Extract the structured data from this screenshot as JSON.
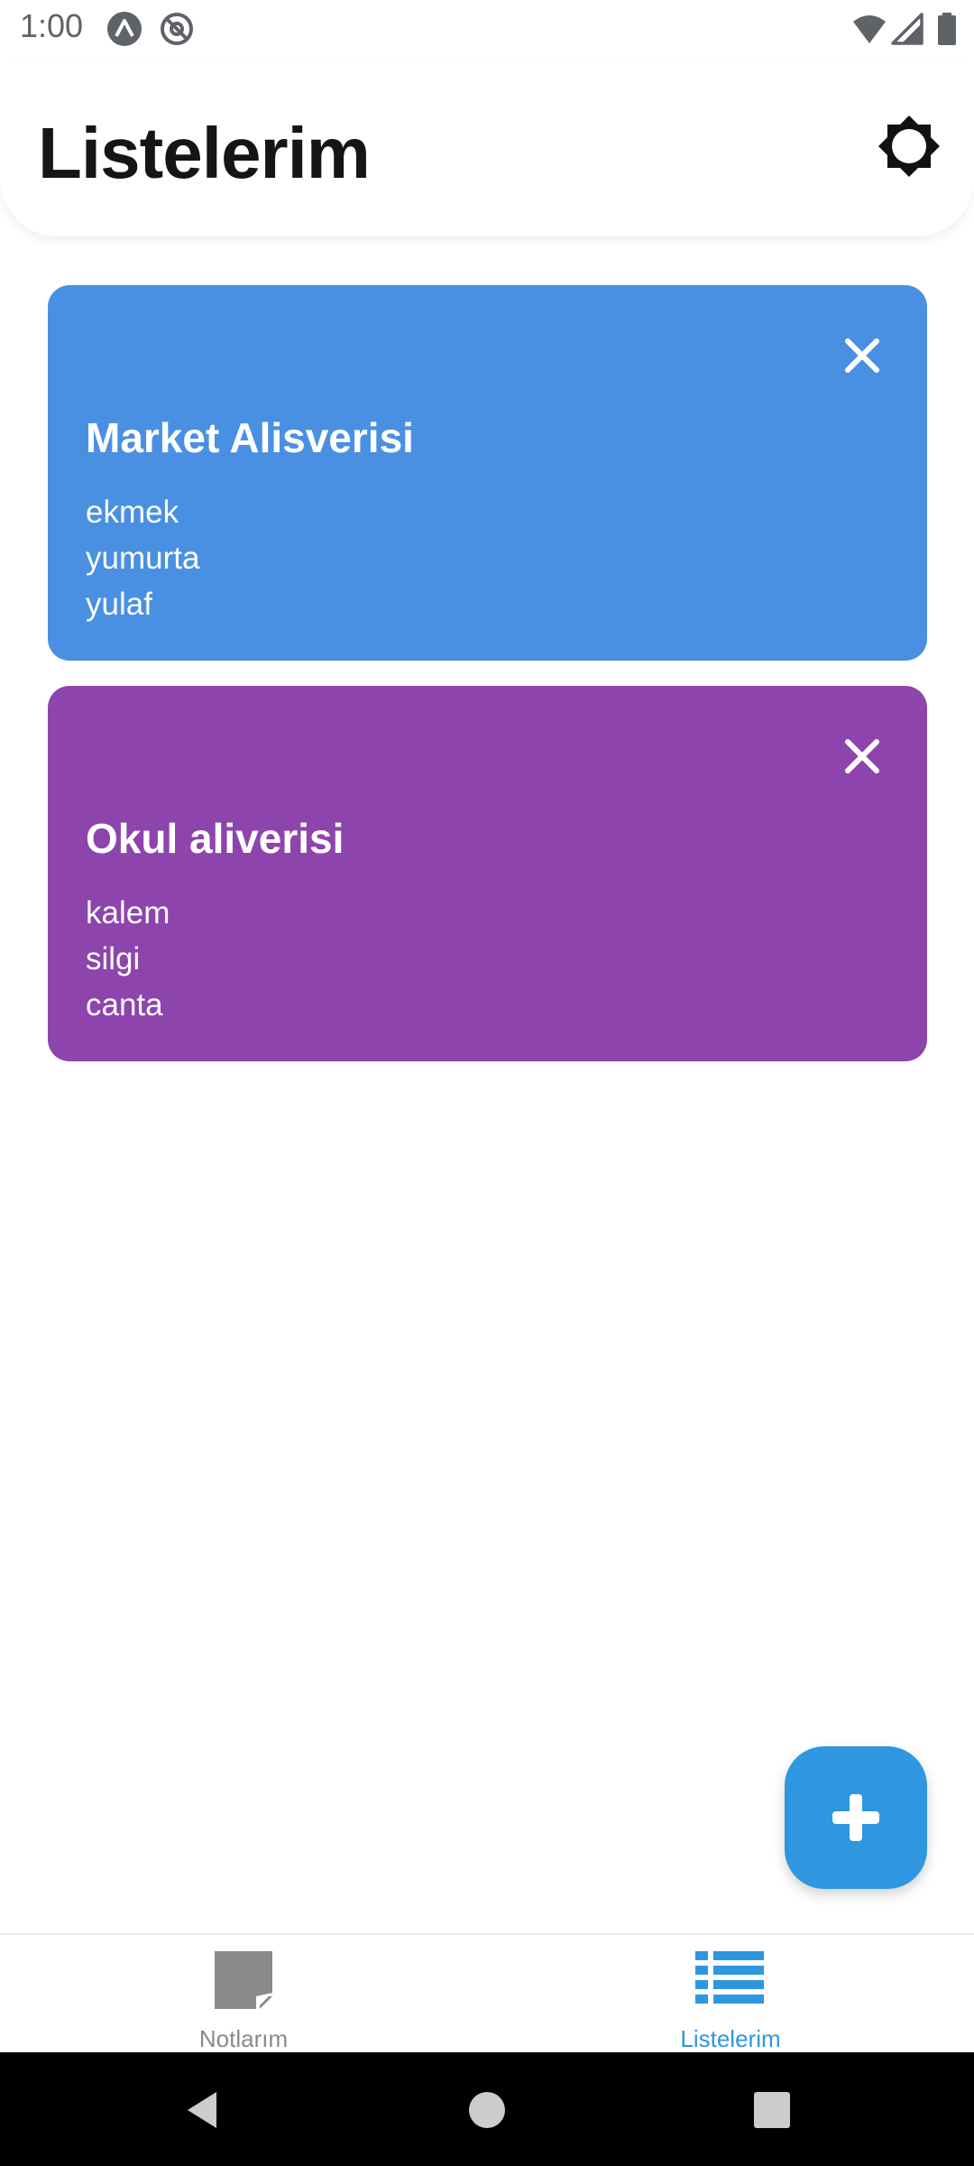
{
  "status_bar": {
    "time": "1:00",
    "icons": [
      "arrow-up-circle-icon",
      "no-sim-alt-icon",
      "wifi-icon",
      "cell-signal-icon",
      "battery-icon"
    ]
  },
  "header": {
    "title": "Listelerim",
    "theme_icon": "sun-icon"
  },
  "lists": [
    {
      "title": "Market Alisverisi",
      "color": "#4a90e2",
      "items": [
        "ekmek",
        "yumurta",
        "yulaf"
      ]
    },
    {
      "title": "Okul aliverisi",
      "color": "#8e44ad",
      "items": [
        "kalem",
        "silgi",
        "canta"
      ]
    }
  ],
  "fab": {
    "icon": "plus-icon",
    "color": "#2e97e0"
  },
  "bottom_nav": {
    "tabs": [
      {
        "label": "Notlarım",
        "icon": "note-icon",
        "active": false
      },
      {
        "label": "Listelerim",
        "icon": "list-icon",
        "active": true
      }
    ],
    "active_color": "#2e97e0",
    "inactive_color": "#8a8a8a"
  },
  "system_nav": [
    "back-icon",
    "home-icon",
    "recents-icon"
  ]
}
